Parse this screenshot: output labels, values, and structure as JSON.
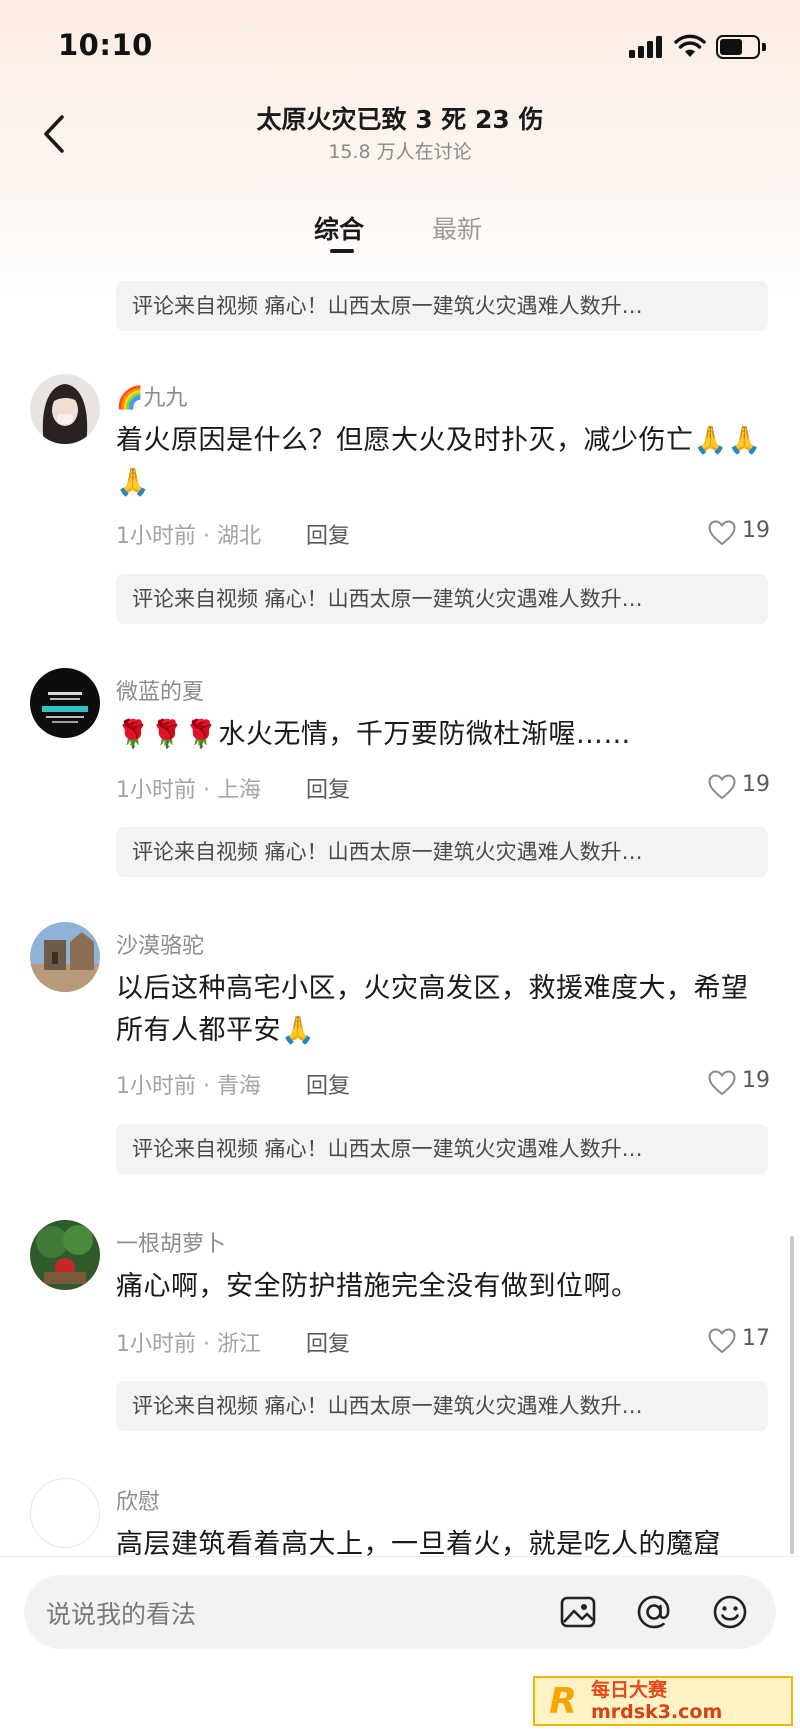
{
  "status_bar": {
    "time": "10:10"
  },
  "header": {
    "title": "太原火灾已致 3 死 23 伤",
    "subtitle": "15.8 万人在讨论"
  },
  "tabs": [
    {
      "label": "综合",
      "active": true
    },
    {
      "label": "最新",
      "active": false
    }
  ],
  "source_pill_text": "评论来自视频 痛心！山西太原一建筑火灾遇难人数升…",
  "comments": [
    {
      "username": "🌈九九",
      "text": "着火原因是什么？但愿大火及时扑灭，减少伤亡🙏🙏🙏",
      "meta": "1小时前 · 湖北",
      "reply": "回复",
      "likes": "19"
    },
    {
      "username": "微蓝的夏",
      "text": "🌹🌹🌹水火无情，千万要防微杜渐喔……",
      "meta": "1小时前 · 上海",
      "reply": "回复",
      "likes": "19"
    },
    {
      "username": "沙漠骆驼",
      "text": "以后这种高宅小区，火灾高发区，救援难度大，希望所有人都平安🙏",
      "meta": "1小时前 · 青海",
      "reply": "回复",
      "likes": "19"
    },
    {
      "username": "一根胡萝卜",
      "text": "痛心啊，安全防护措施完全没有做到位啊。",
      "meta": "1小时前 · 浙江",
      "reply": "回复",
      "likes": "17"
    },
    {
      "username": "欣慰",
      "text": "高层建筑看着高大上，一旦着火，就是吃人的魔窟"
    }
  ],
  "input": {
    "placeholder": "说说我的看法"
  },
  "icons": [
    "back-arrow-icon",
    "image-icon",
    "at-sign-icon",
    "emoji-icon",
    "heart-icon"
  ],
  "watermark": {
    "logo": "R",
    "name": "每日大赛",
    "url": "mrdsk3.com"
  },
  "colors": {
    "accent_text": "#1a1a1a",
    "secondary_text": "#8c8c8c",
    "pill_bg": "#f3f3f3"
  }
}
